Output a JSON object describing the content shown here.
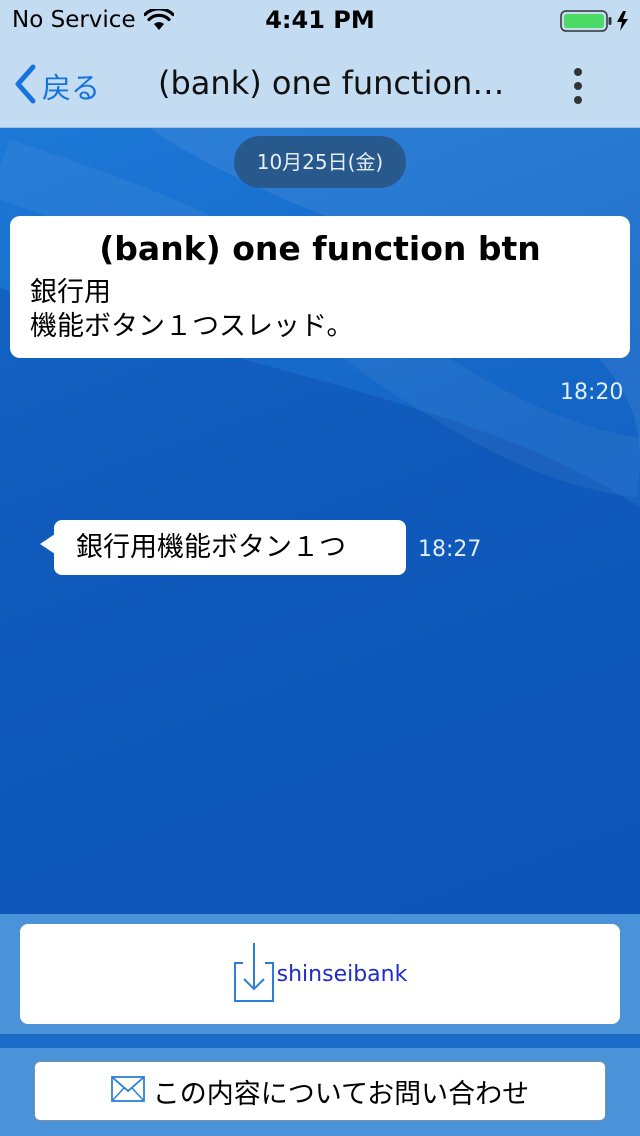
{
  "status_bar": {
    "carrier": "No Service",
    "time": "4:41 PM",
    "wifi_icon": "wifi-icon",
    "battery_icon": "battery-charging-icon",
    "battery_color": "#4cd964"
  },
  "nav": {
    "back_label": "戻る",
    "back_icon": "chevron-left-icon",
    "title": "(bank) one function…",
    "more_icon": "more-vertical-icon",
    "accent_color": "#1673de"
  },
  "chat": {
    "date_label": "10月25日(金)",
    "messages": [
      {
        "title": "(bank) one function btn",
        "body_lines": [
          "銀行用",
          "機能ボタン１つスレッド。"
        ],
        "time": "18:20"
      },
      {
        "text": "銀行用機能ボタン１つ",
        "time": "18:27"
      }
    ]
  },
  "actions": {
    "shinsei_label": "shinseibank",
    "shinsei_icon": "download-icon",
    "inquiry_label": "この内容についてお問い合わせ",
    "inquiry_icon": "envelope-icon"
  }
}
